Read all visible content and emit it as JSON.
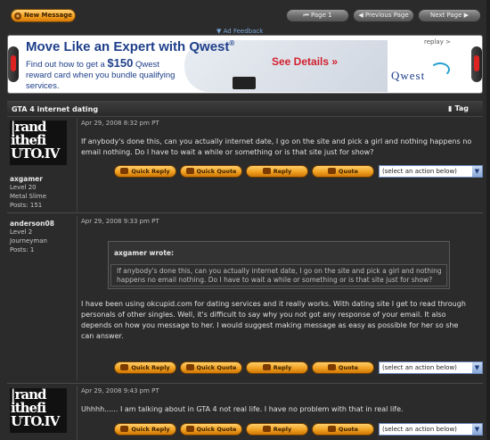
{
  "toolbar": {
    "new_message": "New Message",
    "page_label": "Page 1",
    "previous_page": "Previous Page",
    "next_page": "Next Page",
    "ad_feedback": "▼ Ad Feedback"
  },
  "ad": {
    "headline": "Move Like an Expert with Qwest",
    "reg_mark": "®",
    "body_line1": "Find out how to get a",
    "body_amount": "$150",
    "body_line2": "Qwest reward card when you bundle qualifying services.",
    "see_details": "See Details »",
    "replay": "replay >",
    "logo_text": "Qwest"
  },
  "thread": {
    "title": "GTA 4 internet dating",
    "tag_label": "Tag"
  },
  "post_actions": {
    "quick_reply": "Quick Reply",
    "quick_quote": "Quick Quote",
    "reply": "Reply",
    "quote": "Quote",
    "select_placeholder": "(select an action below)"
  },
  "posts": [
    {
      "logo_lines": [
        "|rand",
        "ithefi",
        "UTO.IV"
      ],
      "username": "axgamer",
      "level": "Level 20",
      "rank": "Metal Slime",
      "posts": "Posts: 151",
      "date": "Apr 29, 2008 8:32 pm PT",
      "text": "If anybody's done this, can you actually internet date, I go on the site and pick a girl and nothing happens no email nothing. Do I have to wait a while or something or is that site just for show?"
    },
    {
      "username": "anderson08",
      "level": "Level 2",
      "rank": "Journeyman",
      "posts": "Posts: 1",
      "date": "Apr 29, 2008 9:33 pm PT",
      "quote_author": "axgamer wrote:",
      "quote_text": "If anybody's done this, can you actually internet date, I go on the site and pick a girl and nothing happens no email nothing. Do I have to wait a while or something or is that site just for show?",
      "text": "I have been using okcupid.com for dating services and it really works. With dating site I get to read through personals of other singles. Well, it's difficult to say why you not got any response of your email. It also depends on how you message to her. I would suggest making message as easy as possible for her so she can answer."
    },
    {
      "logo_lines": [
        "|rand",
        "ithefi",
        "UTO.IV"
      ],
      "date": "Apr 29, 2008 9:43 pm PT",
      "text": "Uhhhh...... I am talking about in GTA 4 not real life. I have no problem with that in real life."
    }
  ]
}
